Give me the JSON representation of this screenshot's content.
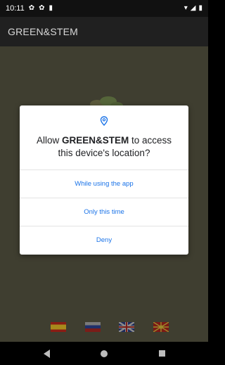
{
  "status_bar": {
    "time": "10:11",
    "icons_left": [
      "settings-icon",
      "settings-icon",
      "sim-icon"
    ],
    "icons_right": [
      "wifi-icon",
      "signal-icon",
      "battery-icon"
    ]
  },
  "app_bar": {
    "title": "GREEN&STEM"
  },
  "dialog": {
    "icon": "location-pin-icon",
    "title_prefix": "Allow ",
    "title_app": "GREEN&STEM",
    "title_suffix": " to access this device's location?",
    "options": [
      {
        "label": "While using the app"
      },
      {
        "label": "Only this time"
      },
      {
        "label": "Deny"
      }
    ]
  },
  "flags": [
    {
      "name": "spain-flag"
    },
    {
      "name": "slovenia-flag"
    },
    {
      "name": "uk-flag"
    },
    {
      "name": "macedonia-flag"
    }
  ],
  "colors": {
    "accent": "#1a73e8",
    "content_bg": "#3f3e30",
    "app_bar_bg": "#202020"
  }
}
